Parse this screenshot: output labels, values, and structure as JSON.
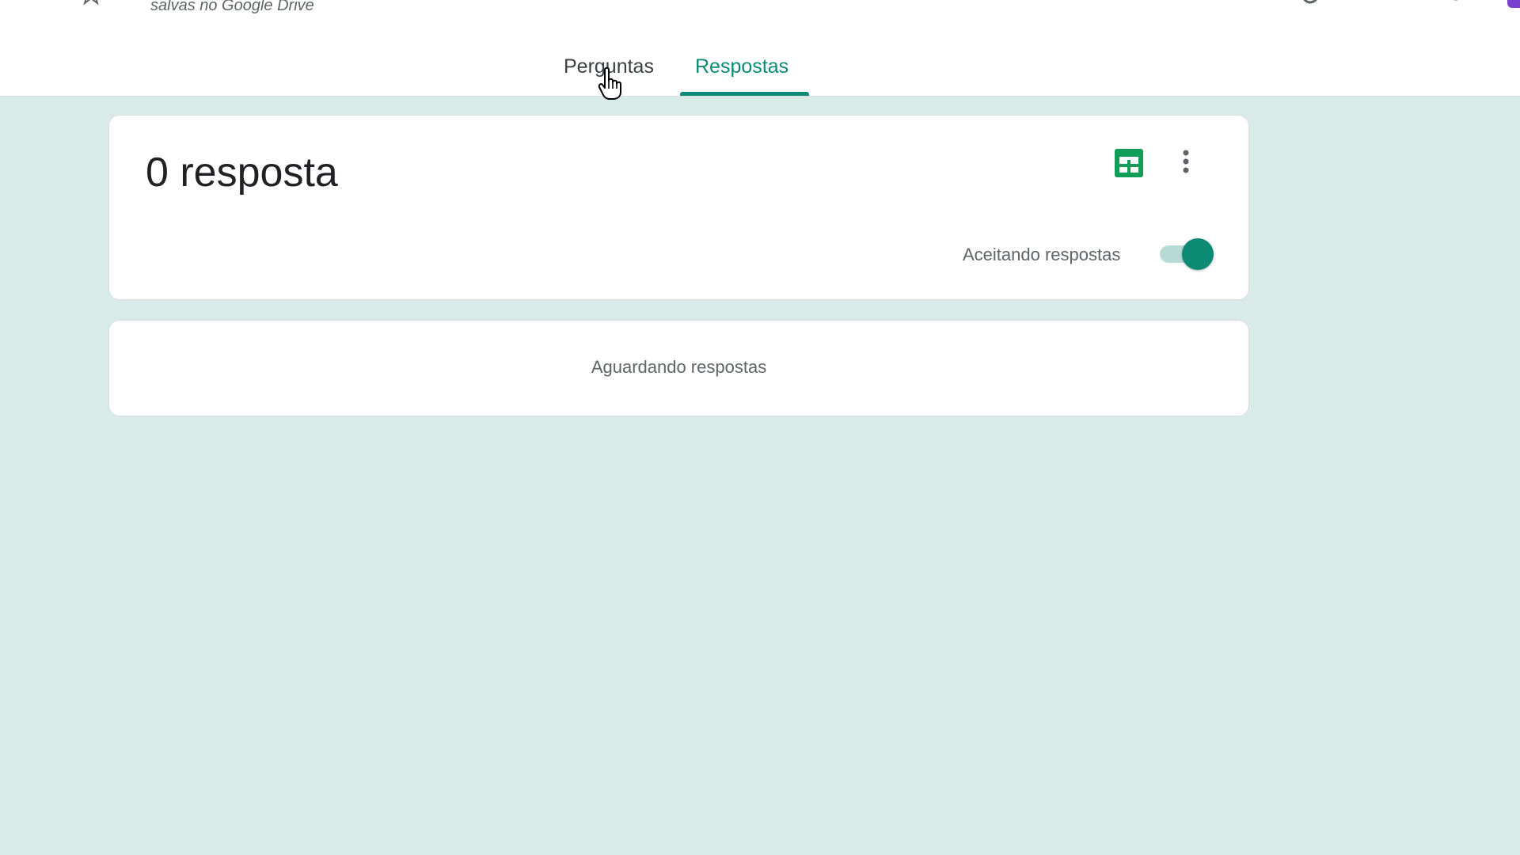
{
  "header": {
    "save_status": "salvas no Google Drive",
    "icons": [
      "menu-icon",
      "star-icon",
      "palette-icon",
      "preview-icon",
      "settings-icon"
    ]
  },
  "tabs": [
    {
      "label": "Perguntas",
      "active": false
    },
    {
      "label": "Respostas",
      "active": true
    }
  ],
  "summary": {
    "response_count": "0 resposta",
    "accepting_label": "Aceitando respostas",
    "accepting": true
  },
  "waiting": {
    "message": "Aguardando respostas"
  },
  "colors": {
    "accent": "#0d8a74",
    "background": "#d9ebe8",
    "sheets_green": "#0f9d58"
  }
}
